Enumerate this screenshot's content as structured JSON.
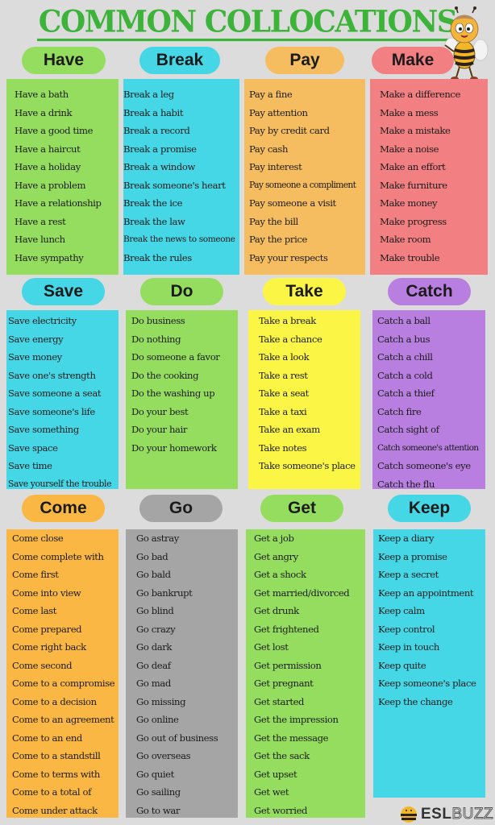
{
  "title": "COMMON COLLOCATIONS",
  "brand": {
    "bold": "ESL",
    "light": "BUZZ",
    "mascot": "bee-mascot-icon"
  },
  "colors": {
    "title": "#3db33a",
    "background": "#dcdcdc"
  },
  "groups": [
    {
      "verb": "Have",
      "color": "#94dd5e",
      "items": [
        "Have a bath",
        "Have a drink",
        "Have a good time",
        "Have a haircut",
        "Have a holiday",
        "Have a problem",
        "Have a relationship",
        "Have a rest",
        "Have lunch",
        "Have sympathy"
      ]
    },
    {
      "verb": "Break",
      "color": "#45d7e6",
      "items": [
        "Break a leg",
        "Break a habit",
        "Break a record",
        "Break a promise",
        "Break a window",
        "Break someone's heart",
        "Break the ice",
        "Break the law",
        "Break the news to someone",
        "Break the rules"
      ]
    },
    {
      "verb": "Pay",
      "color": "#f6bd60",
      "items": [
        "Pay a fine",
        "Pay attention",
        "Pay by credit card",
        "Pay cash",
        "Pay interest",
        "Pay someone a compliment",
        "Pay someone a visit",
        "Pay the bill",
        "Pay the price",
        "Pay your respects"
      ]
    },
    {
      "verb": "Make",
      "color": "#f27f82",
      "items": [
        "Make a difference",
        "Make a mess",
        "Make a mistake",
        "Make a noise",
        "Make an effort",
        "Make furniture",
        "Make money",
        "Make progress",
        "Make room",
        "Make trouble"
      ]
    },
    {
      "verb": "Save",
      "color": "#45d7e6",
      "items": [
        "Save electricity",
        "Save energy",
        "Save money",
        "Save one's strength",
        "Save someone a seat",
        "Save someone's life",
        "Save something",
        "Save space",
        "Save time",
        "Save yourself the trouble"
      ]
    },
    {
      "verb": "Do",
      "color": "#94dd5e",
      "items": [
        "Do business",
        "Do nothing",
        "Do someone a favor",
        "Do the cooking",
        "Do the washing up",
        "Do your best",
        "Do your hair",
        "Do your homework"
      ]
    },
    {
      "verb": "Take",
      "color": "#fbf546",
      "items": [
        "Take a break",
        "Take a chance",
        "Take a look",
        "Take a rest",
        "Take a seat",
        "Take a taxi",
        "Take an exam",
        "Take notes",
        "Take someone's place"
      ]
    },
    {
      "verb": "Catch",
      "color": "#b97fe0",
      "items": [
        "Catch a ball",
        "Catch a bus",
        "Catch a chill",
        "Catch a cold",
        "Catch a thief",
        "Catch fire",
        "Catch sight of",
        "Catch someone's attention",
        "Catch someone's eye",
        "Catch the flu"
      ]
    },
    {
      "verb": "Come",
      "color": "#fbb743",
      "items": [
        "Come close",
        "Come complete with",
        "Come first",
        "Come into view",
        "Come last",
        "Come prepared",
        "Come right back",
        "Come second",
        "Come to a compromise",
        "Come to a decision",
        "Come to an agreement",
        "Come to an end",
        "Come to a standstill",
        "Come to terms with",
        "Come to a total of",
        "Come under attack"
      ]
    },
    {
      "verb": "Go",
      "color": "#a5a5a5",
      "items": [
        "Go astray",
        "Go bad",
        "Go bald",
        "Go bankrupt",
        "Go blind",
        "Go crazy",
        "Go dark",
        "Go deaf",
        "Go mad",
        "Go missing",
        "Go online",
        "Go out of business",
        "Go overseas",
        "Go quiet",
        "Go sailing",
        "Go to war"
      ]
    },
    {
      "verb": "Get",
      "color": "#94dd5e",
      "items": [
        "Get a job",
        "Get angry",
        "Get a shock",
        "Get married/divorced",
        "Get drunk",
        "Get frightened",
        "Get lost",
        "Get permission",
        "Get pregnant",
        "Get started",
        "Get the impression",
        "Get the message",
        "Get the sack",
        "Get upset",
        "Get wet",
        "Get worried"
      ]
    },
    {
      "verb": "Keep",
      "color": "#45d7e6",
      "items": [
        "Keep a diary",
        "Keep a promise",
        "Keep a secret",
        "Keep an appointment",
        "Keep calm",
        "Keep control",
        "Keep in touch",
        "Keep quite",
        "Keep someone's place",
        "Keep the change"
      ]
    }
  ]
}
